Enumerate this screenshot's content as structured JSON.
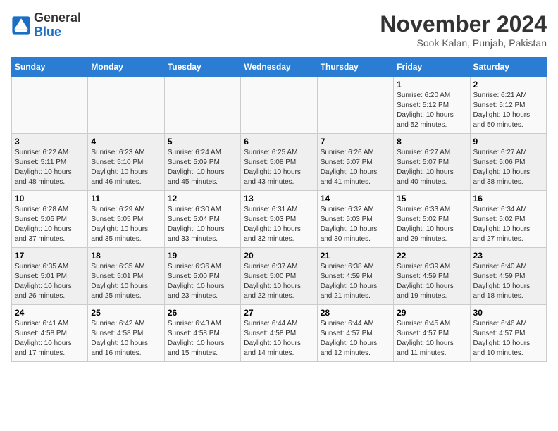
{
  "logo": {
    "general": "General",
    "blue": "Blue"
  },
  "title": "November 2024",
  "location": "Sook Kalan, Punjab, Pakistan",
  "days_of_week": [
    "Sunday",
    "Monday",
    "Tuesday",
    "Wednesday",
    "Thursday",
    "Friday",
    "Saturday"
  ],
  "weeks": [
    [
      {
        "day": "",
        "info": ""
      },
      {
        "day": "",
        "info": ""
      },
      {
        "day": "",
        "info": ""
      },
      {
        "day": "",
        "info": ""
      },
      {
        "day": "",
        "info": ""
      },
      {
        "day": "1",
        "info": "Sunrise: 6:20 AM\nSunset: 5:12 PM\nDaylight: 10 hours and 52 minutes."
      },
      {
        "day": "2",
        "info": "Sunrise: 6:21 AM\nSunset: 5:12 PM\nDaylight: 10 hours and 50 minutes."
      }
    ],
    [
      {
        "day": "3",
        "info": "Sunrise: 6:22 AM\nSunset: 5:11 PM\nDaylight: 10 hours and 48 minutes."
      },
      {
        "day": "4",
        "info": "Sunrise: 6:23 AM\nSunset: 5:10 PM\nDaylight: 10 hours and 46 minutes."
      },
      {
        "day": "5",
        "info": "Sunrise: 6:24 AM\nSunset: 5:09 PM\nDaylight: 10 hours and 45 minutes."
      },
      {
        "day": "6",
        "info": "Sunrise: 6:25 AM\nSunset: 5:08 PM\nDaylight: 10 hours and 43 minutes."
      },
      {
        "day": "7",
        "info": "Sunrise: 6:26 AM\nSunset: 5:07 PM\nDaylight: 10 hours and 41 minutes."
      },
      {
        "day": "8",
        "info": "Sunrise: 6:27 AM\nSunset: 5:07 PM\nDaylight: 10 hours and 40 minutes."
      },
      {
        "day": "9",
        "info": "Sunrise: 6:27 AM\nSunset: 5:06 PM\nDaylight: 10 hours and 38 minutes."
      }
    ],
    [
      {
        "day": "10",
        "info": "Sunrise: 6:28 AM\nSunset: 5:05 PM\nDaylight: 10 hours and 37 minutes."
      },
      {
        "day": "11",
        "info": "Sunrise: 6:29 AM\nSunset: 5:05 PM\nDaylight: 10 hours and 35 minutes."
      },
      {
        "day": "12",
        "info": "Sunrise: 6:30 AM\nSunset: 5:04 PM\nDaylight: 10 hours and 33 minutes."
      },
      {
        "day": "13",
        "info": "Sunrise: 6:31 AM\nSunset: 5:03 PM\nDaylight: 10 hours and 32 minutes."
      },
      {
        "day": "14",
        "info": "Sunrise: 6:32 AM\nSunset: 5:03 PM\nDaylight: 10 hours and 30 minutes."
      },
      {
        "day": "15",
        "info": "Sunrise: 6:33 AM\nSunset: 5:02 PM\nDaylight: 10 hours and 29 minutes."
      },
      {
        "day": "16",
        "info": "Sunrise: 6:34 AM\nSunset: 5:02 PM\nDaylight: 10 hours and 27 minutes."
      }
    ],
    [
      {
        "day": "17",
        "info": "Sunrise: 6:35 AM\nSunset: 5:01 PM\nDaylight: 10 hours and 26 minutes."
      },
      {
        "day": "18",
        "info": "Sunrise: 6:35 AM\nSunset: 5:01 PM\nDaylight: 10 hours and 25 minutes."
      },
      {
        "day": "19",
        "info": "Sunrise: 6:36 AM\nSunset: 5:00 PM\nDaylight: 10 hours and 23 minutes."
      },
      {
        "day": "20",
        "info": "Sunrise: 6:37 AM\nSunset: 5:00 PM\nDaylight: 10 hours and 22 minutes."
      },
      {
        "day": "21",
        "info": "Sunrise: 6:38 AM\nSunset: 4:59 PM\nDaylight: 10 hours and 21 minutes."
      },
      {
        "day": "22",
        "info": "Sunrise: 6:39 AM\nSunset: 4:59 PM\nDaylight: 10 hours and 19 minutes."
      },
      {
        "day": "23",
        "info": "Sunrise: 6:40 AM\nSunset: 4:59 PM\nDaylight: 10 hours and 18 minutes."
      }
    ],
    [
      {
        "day": "24",
        "info": "Sunrise: 6:41 AM\nSunset: 4:58 PM\nDaylight: 10 hours and 17 minutes."
      },
      {
        "day": "25",
        "info": "Sunrise: 6:42 AM\nSunset: 4:58 PM\nDaylight: 10 hours and 16 minutes."
      },
      {
        "day": "26",
        "info": "Sunrise: 6:43 AM\nSunset: 4:58 PM\nDaylight: 10 hours and 15 minutes."
      },
      {
        "day": "27",
        "info": "Sunrise: 6:44 AM\nSunset: 4:58 PM\nDaylight: 10 hours and 14 minutes."
      },
      {
        "day": "28",
        "info": "Sunrise: 6:44 AM\nSunset: 4:57 PM\nDaylight: 10 hours and 12 minutes."
      },
      {
        "day": "29",
        "info": "Sunrise: 6:45 AM\nSunset: 4:57 PM\nDaylight: 10 hours and 11 minutes."
      },
      {
        "day": "30",
        "info": "Sunrise: 6:46 AM\nSunset: 4:57 PM\nDaylight: 10 hours and 10 minutes."
      }
    ]
  ]
}
